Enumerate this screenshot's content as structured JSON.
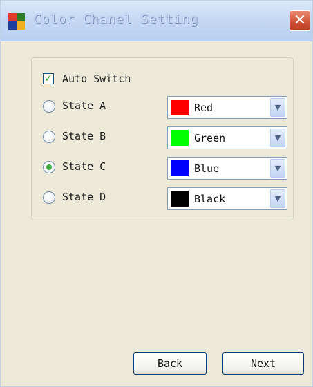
{
  "window": {
    "title": "Color Chanel Setting",
    "close_label": "✕"
  },
  "icons": {
    "app": "app-icon",
    "close": "close-icon",
    "checkmark": "check-icon",
    "dropdown": "chevron-down-icon"
  },
  "auto_switch": {
    "label": "Auto Switch",
    "checked": true
  },
  "states": [
    {
      "label": "State A",
      "selected": false,
      "color_name": "Red",
      "color_hex": "#ff0000"
    },
    {
      "label": "State B",
      "selected": false,
      "color_name": "Green",
      "color_hex": "#00ff00"
    },
    {
      "label": "State C",
      "selected": true,
      "color_name": "Blue",
      "color_hex": "#0000ff"
    },
    {
      "label": "State D",
      "selected": false,
      "color_name": "Black",
      "color_hex": "#000000"
    }
  ],
  "buttons": {
    "back": "Back",
    "next": "Next"
  }
}
